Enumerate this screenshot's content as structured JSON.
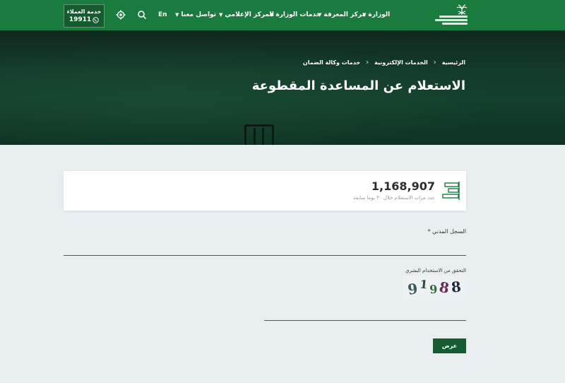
{
  "header": {
    "logo_name": "palm-swords-logo",
    "nav": [
      {
        "label": "الوزارة"
      },
      {
        "label": "مركز المعرفة"
      },
      {
        "label": "خدمات الوزارة"
      },
      {
        "label": "المركز الإعلامي"
      },
      {
        "label": "تواصل معنا"
      }
    ],
    "language": "En",
    "customer_service": {
      "title": "خدمة العملاء",
      "number": "19911"
    }
  },
  "breadcrumb": [
    "الرئيسية",
    "الخدمات الإلكترونية",
    "خدمات وكالة الضمان"
  ],
  "page_title": "الاستعلام عن المساعدة المقطوعة",
  "stats": {
    "value": "1,168,907",
    "label": "عدد مرات الاستعلام خلال ٣٠ يوما سابقة"
  },
  "form": {
    "civil_record_label": "السجل المدني *",
    "civil_record_value": "",
    "captcha_label": "التحقق من الاستخدام البشري",
    "captcha_chars": [
      "9",
      "1",
      "9",
      "8",
      "8"
    ],
    "captcha_value": "",
    "submit_label": "عرض"
  },
  "colors": {
    "brand_green": "#1a7b3e",
    "dark_green": "#145c30",
    "background": "#e9eef1"
  }
}
